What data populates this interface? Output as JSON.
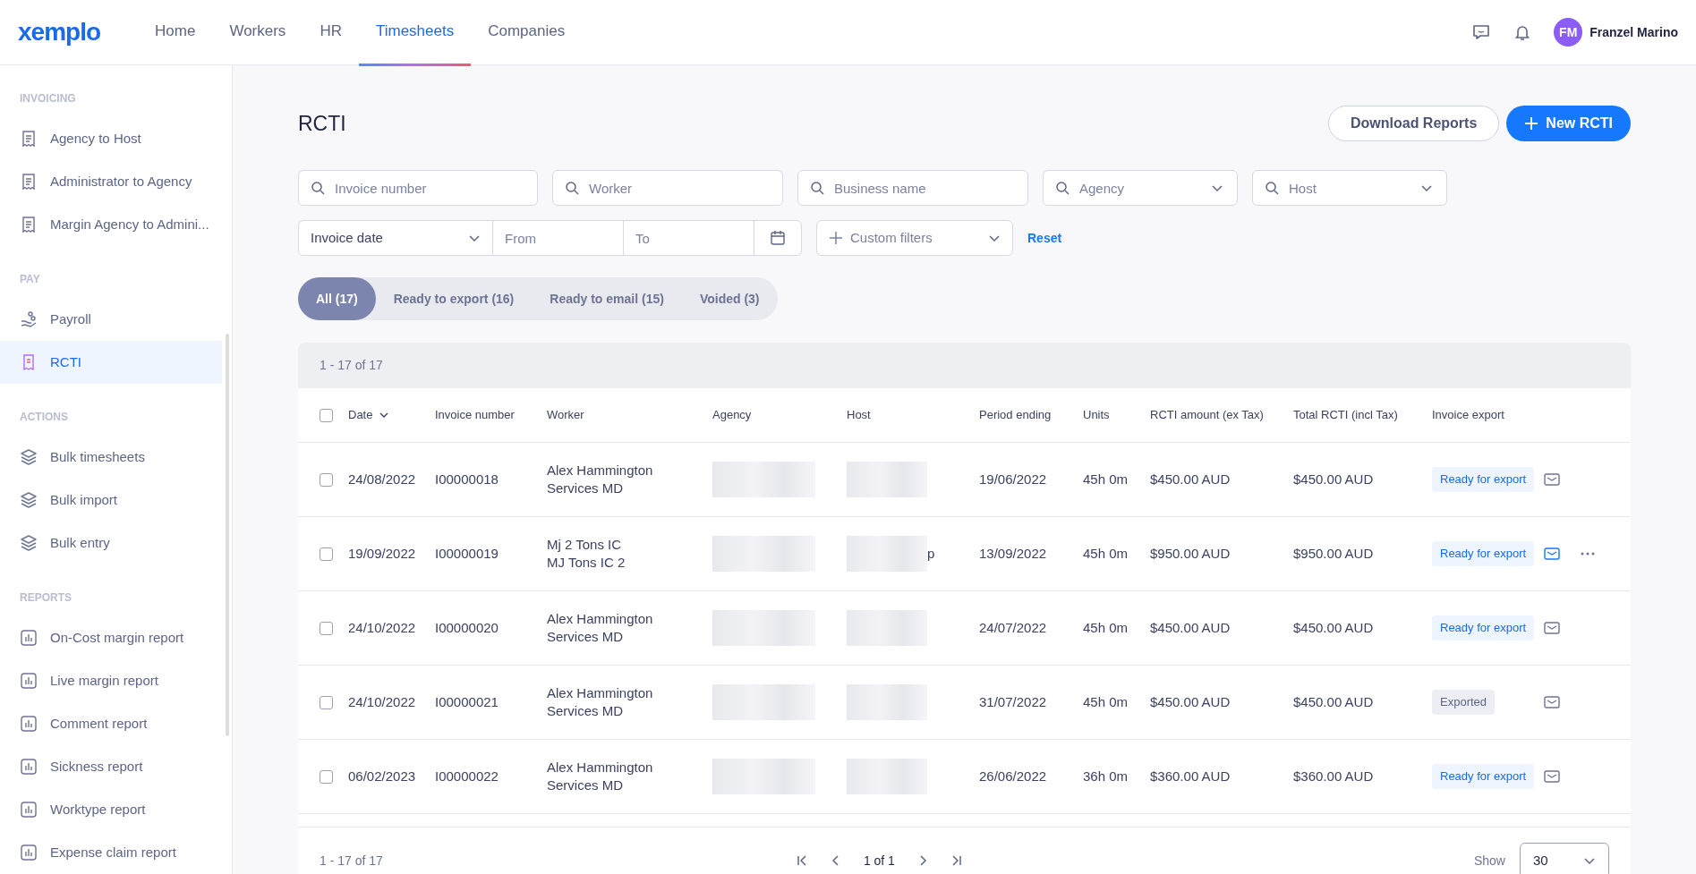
{
  "brand": {
    "logo": "xemplo"
  },
  "nav": [
    {
      "label": "Home",
      "selected": false
    },
    {
      "label": "Workers",
      "selected": false
    },
    {
      "label": "HR",
      "selected": false
    },
    {
      "label": "Timesheets",
      "selected": true
    },
    {
      "label": "Companies",
      "selected": false
    }
  ],
  "user": {
    "initials": "FM",
    "name": "Franzel Marino"
  },
  "sidebar": {
    "sections": [
      {
        "title": "INVOICING",
        "items": [
          {
            "label": "Agency to Host",
            "kind": "receipt",
            "selected": false
          },
          {
            "label": "Administrator to Agency",
            "kind": "receipt",
            "selected": false
          },
          {
            "label": "Margin Agency to Admini...",
            "kind": "receipt",
            "selected": false
          }
        ]
      },
      {
        "title": "PAY",
        "items": [
          {
            "label": "Payroll",
            "kind": "payroll",
            "selected": false
          },
          {
            "label": "RCTI",
            "kind": "rcti",
            "selected": true
          }
        ]
      },
      {
        "title": "ACTIONS",
        "items": [
          {
            "label": "Bulk timesheets",
            "kind": "layers",
            "selected": false
          },
          {
            "label": "Bulk import",
            "kind": "layers",
            "selected": false
          },
          {
            "label": "Bulk entry",
            "kind": "layers",
            "selected": false
          }
        ]
      },
      {
        "title": "REPORTS",
        "items": [
          {
            "label": "On-Cost margin report",
            "kind": "report",
            "selected": false
          },
          {
            "label": "Live margin report",
            "kind": "report",
            "selected": false
          },
          {
            "label": "Comment report",
            "kind": "report",
            "selected": false
          },
          {
            "label": "Sickness report",
            "kind": "report",
            "selected": false
          },
          {
            "label": "Worktype report",
            "kind": "report",
            "selected": false
          },
          {
            "label": "Expense claim report",
            "kind": "report",
            "selected": false
          }
        ]
      }
    ]
  },
  "page": {
    "title": "RCTI",
    "buttons": [
      "Download Reports",
      "New RCTI"
    ]
  },
  "filters": [
    {
      "placeholder": "Invoice number",
      "kind": "search"
    },
    {
      "placeholder": "Worker",
      "kind": "search"
    },
    {
      "placeholder": "Business name",
      "kind": "search"
    },
    {
      "placeholder": "Agency",
      "kind": "select"
    },
    {
      "placeholder": "Host",
      "kind": "select"
    }
  ],
  "date_filter": {
    "type": "Invoice date",
    "from_placeholder": "From",
    "to_placeholder": "To"
  },
  "custom_filters": "Custom filters",
  "reset": "Reset",
  "tabs": [
    {
      "label": "All (17)",
      "selected": true
    },
    {
      "label": "Ready to export (16)",
      "selected": false
    },
    {
      "label": "Ready to email (15)",
      "selected": false
    },
    {
      "label": "Voided (3)",
      "selected": false
    }
  ],
  "table": {
    "range": "1 - 17 of 17",
    "select_all_checked": false,
    "columns": [
      "Date",
      "Invoice number",
      "Worker",
      "Agency",
      "Host",
      "Period ending",
      "Units",
      "RCTI amount (ex Tax)",
      "Total RCTI (incl Tax)",
      "Invoice export"
    ],
    "rows": [
      {
        "checked": false,
        "date": "24/08/2022",
        "invoice": "I00000018",
        "worker": [
          "Alex Hammington",
          "Services MD"
        ],
        "period": "19/06/2022",
        "units": "45h 0m",
        "amount": "$450.00 AUD",
        "total": "$450.00 AUD",
        "status": "Ready for export",
        "exported": false,
        "hovered": false
      },
      {
        "checked": false,
        "date": "19/09/2022",
        "invoice": "I00000019",
        "worker": [
          "Mj 2 Tons IC",
          "MJ Tons IC 2"
        ],
        "host_visible": "p",
        "period": "13/09/2022",
        "units": "45h 0m",
        "amount": "$950.00 AUD",
        "total": "$950.00 AUD",
        "status": "Ready for export",
        "exported": false,
        "hovered": true
      },
      {
        "checked": false,
        "date": "24/10/2022",
        "invoice": "I00000020",
        "worker": [
          "Alex Hammington",
          "Services MD"
        ],
        "period": "24/07/2022",
        "units": "45h 0m",
        "amount": "$450.00 AUD",
        "total": "$450.00 AUD",
        "status": "Ready for export",
        "exported": false,
        "hovered": false
      },
      {
        "checked": false,
        "date": "24/10/2022",
        "invoice": "I00000021",
        "worker": [
          "Alex Hammington",
          "Services MD"
        ],
        "period": "31/07/2022",
        "units": "45h 0m",
        "amount": "$450.00 AUD",
        "total": "$450.00 AUD",
        "status": "Exported",
        "exported": true,
        "hovered": false
      },
      {
        "checked": false,
        "date": "06/02/2023",
        "invoice": "I00000022",
        "worker": [
          "Alex Hammington",
          "Services MD"
        ],
        "period": "26/06/2022",
        "units": "36h 0m",
        "amount": "$360.00 AUD",
        "total": "$360.00 AUD",
        "status": "Ready for export",
        "exported": false,
        "hovered": false
      }
    ]
  },
  "footer": {
    "range": "1 - 17 of 17",
    "page": "1 of 1",
    "show_label": "Show",
    "page_size": "30"
  }
}
